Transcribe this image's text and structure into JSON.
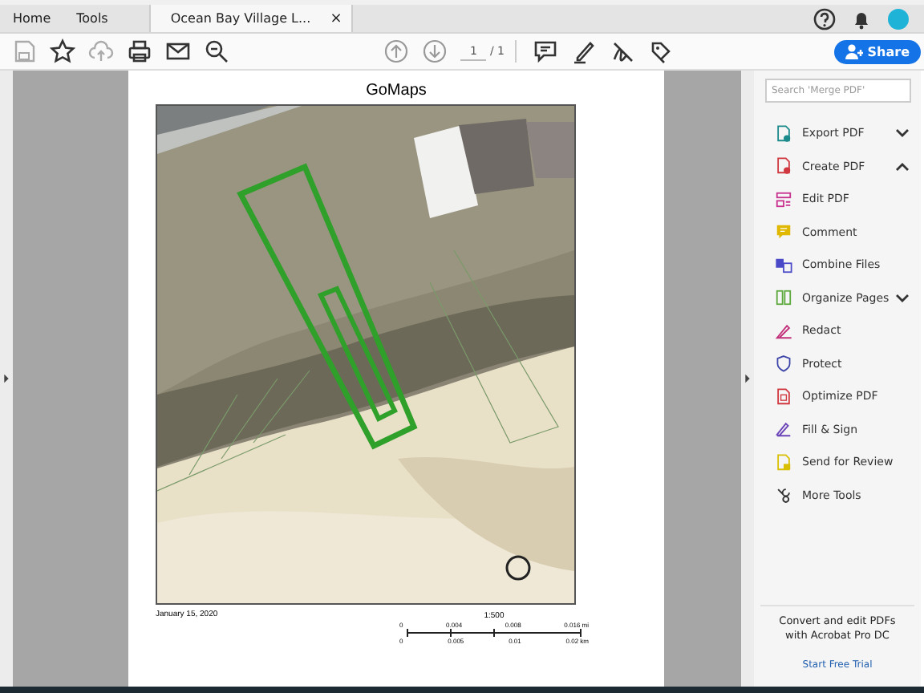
{
  "tabs": [
    {
      "label": "Home",
      "selected": false
    },
    {
      "label": "Tools",
      "selected": false
    },
    {
      "label": "Ocean Bay Village L...",
      "selected": true,
      "close": "×"
    }
  ],
  "toolbar": {
    "page_current": "1",
    "page_total": "/ 1",
    "share": "Share"
  },
  "document": {
    "title": "GoMaps",
    "date": "January 15, 2020",
    "scale": "1:500",
    "scale_miles": [
      "0",
      "0.004",
      "0.008",
      "0.016 mi"
    ],
    "scale_km": [
      "0",
      "0.005",
      "0.01",
      "0.02 km"
    ]
  },
  "tools_panel": {
    "search": {
      "placeholder": "Search 'Merge PDF'"
    },
    "items": [
      {
        "label": "Export PDF",
        "color": "#1a8a8a",
        "expanded": false
      },
      {
        "label": "Create PDF",
        "color": "#d0373f",
        "expanded": true
      },
      {
        "label": "Edit PDF",
        "color": "#c7308f"
      },
      {
        "label": "Comment",
        "color": "#e1b800"
      },
      {
        "label": "Combine Files",
        "color": "#4a4ac8"
      },
      {
        "label": "Organize Pages",
        "color": "#5aa83a",
        "expanded": false
      },
      {
        "label": "Redact",
        "color": "#c2307a"
      },
      {
        "label": "Protect",
        "color": "#3d45a8"
      },
      {
        "label": "Optimize PDF",
        "color": "#d0373f"
      },
      {
        "label": "Fill & Sign",
        "color": "#6b44b8"
      },
      {
        "label": "Send for Review",
        "color": "#d8c000"
      },
      {
        "label": "More Tools",
        "color": "#333333"
      }
    ],
    "promo": {
      "text": "Convert and edit PDFs with Acrobat Pro DC",
      "link": "Start Free Trial"
    }
  }
}
